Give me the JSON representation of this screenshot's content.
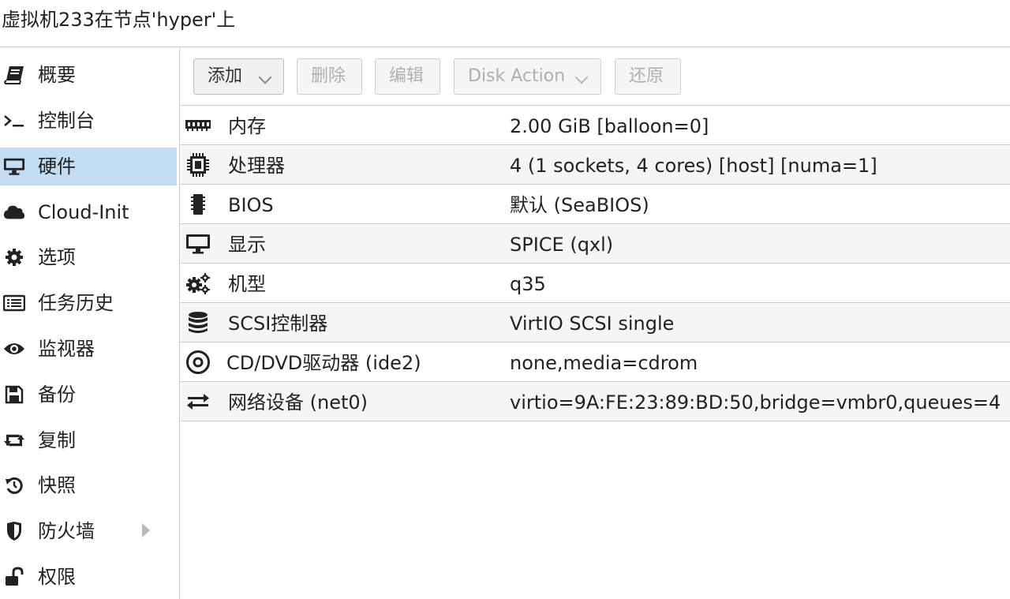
{
  "window": {
    "title": "虚拟机233在节点'hyper'上"
  },
  "sidebar": {
    "items": [
      {
        "label": "概要",
        "icon": "book-icon"
      },
      {
        "label": "控制台",
        "icon": "terminal-icon"
      },
      {
        "label": "硬件",
        "icon": "desktop-icon",
        "active": true
      },
      {
        "label": "Cloud-Init",
        "icon": "cloud-icon"
      },
      {
        "label": "选项",
        "icon": "gear-icon"
      },
      {
        "label": "任务历史",
        "icon": "list-icon"
      },
      {
        "label": "监视器",
        "icon": "eye-icon"
      },
      {
        "label": "备份",
        "icon": "floppy-icon"
      },
      {
        "label": "复制",
        "icon": "retweet-icon"
      },
      {
        "label": "快照",
        "icon": "history-icon"
      },
      {
        "label": "防火墙",
        "icon": "shield-icon",
        "expandable": true
      },
      {
        "label": "权限",
        "icon": "unlock-icon"
      }
    ]
  },
  "toolbar": {
    "add_label": "添加",
    "remove_label": "删除",
    "edit_label": "编辑",
    "disk_action_label": "Disk Action",
    "revert_label": "还原"
  },
  "hardware": {
    "rows": [
      {
        "name": "内存",
        "value": "2.00 GiB [balloon=0]",
        "icon": "memory-icon"
      },
      {
        "name": "处理器",
        "value": "4 (1 sockets, 4 cores) [host] [numa=1]",
        "icon": "cpu-icon"
      },
      {
        "name": "BIOS",
        "value": "默认 (SeaBIOS)",
        "icon": "microchip-icon"
      },
      {
        "name": "显示",
        "value": "SPICE (qxl)",
        "icon": "desktop-icon"
      },
      {
        "name": "机型",
        "value": "q35",
        "icon": "cogs-icon"
      },
      {
        "name": "SCSI控制器",
        "value": "VirtIO SCSI single",
        "icon": "database-icon"
      },
      {
        "name": "CD/DVD驱动器 (ide2)",
        "value": "none,media=cdrom",
        "icon": "cdrom-icon"
      },
      {
        "name": "网络设备 (net0)",
        "value": "virtio=9A:FE:23:89:BD:50,bridge=vmbr0,queues=4",
        "icon": "exchange-icon"
      }
    ]
  },
  "colors": {
    "selected_background": "#c2ddf2",
    "alt_row_background": "#f5f5f5",
    "border": "#c9c9c9"
  }
}
